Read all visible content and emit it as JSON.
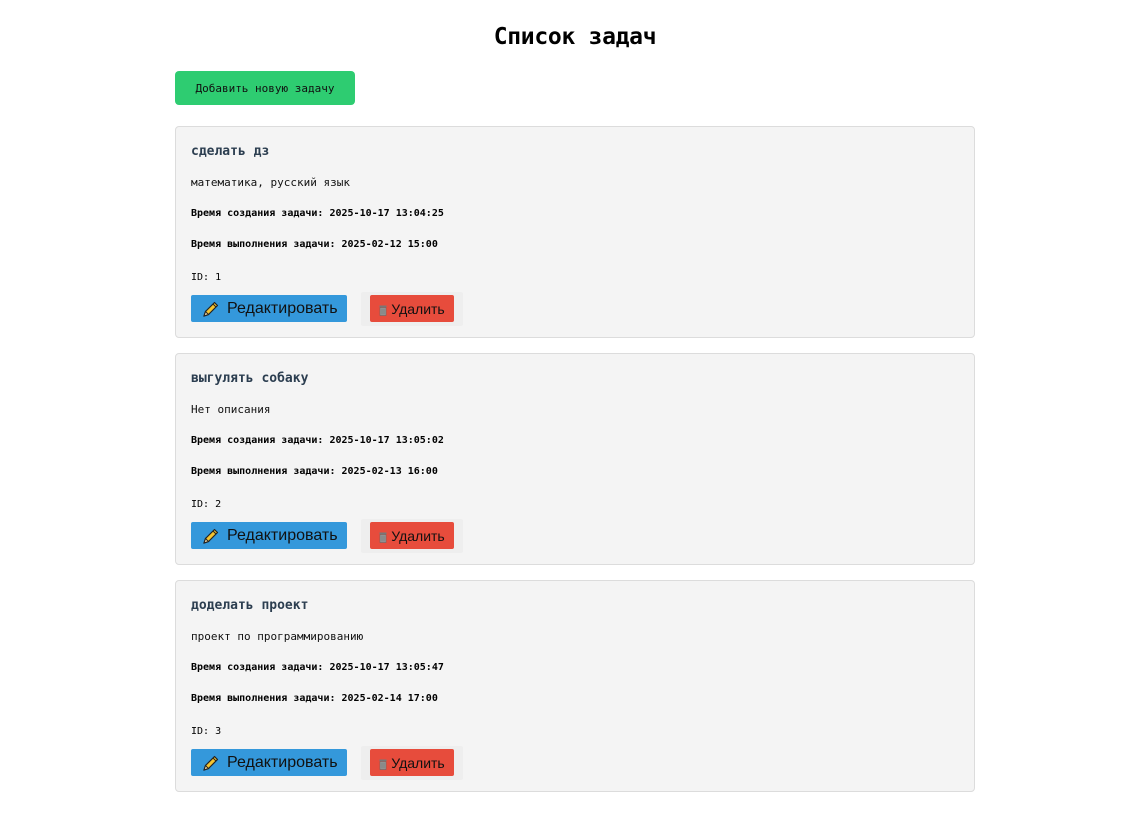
{
  "page": {
    "title": "Список задач",
    "add_button_label": "Добавить новую задачу"
  },
  "colors": {
    "add_button": "#2ecc71",
    "edit_button": "#3498db",
    "delete_button": "#e74c3c",
    "task_title": "#2c3e50",
    "card_background": "#f4f4f4"
  },
  "icons": {
    "edit": "pencil-icon",
    "delete": "trash-icon"
  },
  "tasks": [
    {
      "title": "сделать дз",
      "description": "математика, русский язык",
      "created": "Время создания задачи: 2025-10-17 13:04:25",
      "due": "Время выполнения задачи: 2025-02-12 15:00",
      "id_text": "ID: 1",
      "edit_label": "Редактировать",
      "delete_label": "Удалить"
    },
    {
      "title": "выгулять собаку",
      "description": "Нет описания",
      "created": "Время создания задачи: 2025-10-17 13:05:02",
      "due": "Время выполнения задачи: 2025-02-13 16:00",
      "id_text": "ID: 2",
      "edit_label": "Редактировать",
      "delete_label": "Удалить"
    },
    {
      "title": "доделать проект",
      "description": "проект по программированию",
      "created": "Время создания задачи: 2025-10-17 13:05:47",
      "due": "Время выполнения задачи: 2025-02-14 17:00",
      "id_text": "ID: 3",
      "edit_label": "Редактировать",
      "delete_label": "Удалить"
    }
  ]
}
